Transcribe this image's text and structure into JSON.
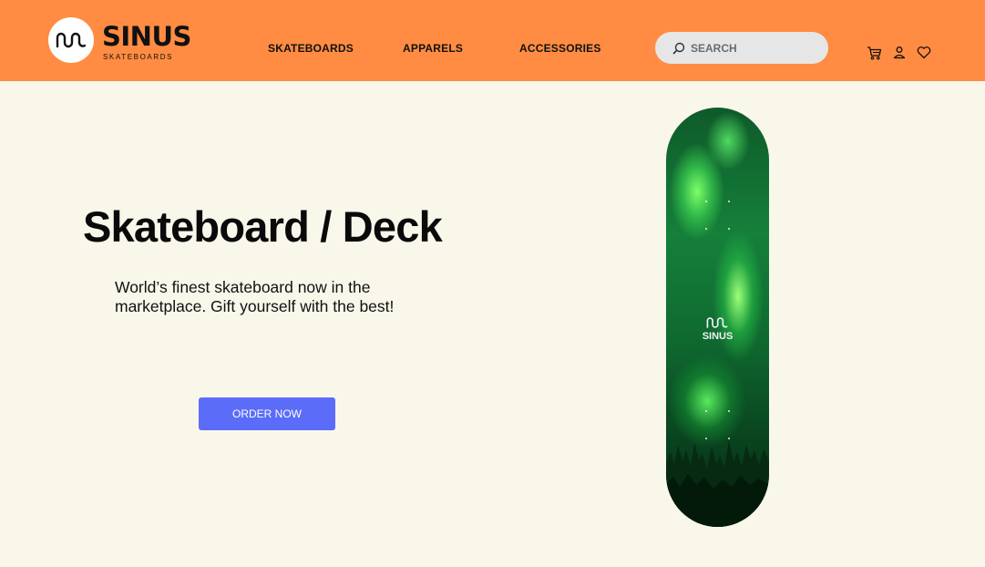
{
  "brand": {
    "name": "SINUS",
    "tagline": "SKATEBOARDS"
  },
  "nav": {
    "items": [
      {
        "label": "SKATEBOARDS"
      },
      {
        "label": "APPARELS"
      },
      {
        "label": "ACCESSORIES"
      }
    ]
  },
  "search": {
    "placeholder": "SEARCH",
    "value": ""
  },
  "header_icons": [
    "cart-icon",
    "user-icon",
    "heart-icon"
  ],
  "hero": {
    "title": "Skateboard / Deck",
    "description": "World’s finest skateboard now in the marketplace. Gift yourself with the best!",
    "cta_label": "ORDER NOW"
  },
  "product": {
    "deck_brand": "SINUS"
  },
  "colors": {
    "header_bg": "#ff8c42",
    "page_bg": "#f9f7ea",
    "cta_bg": "#5b6cf9",
    "search_bg": "#e6e6e6"
  }
}
